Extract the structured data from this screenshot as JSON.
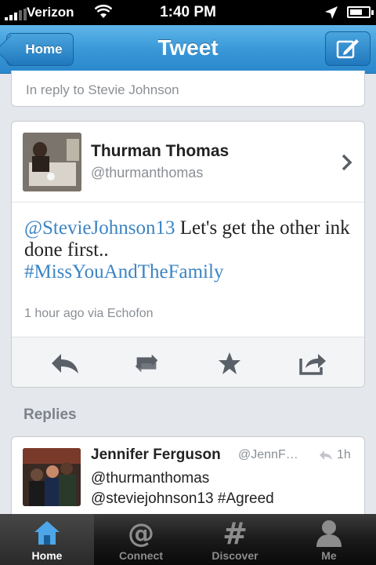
{
  "status_bar": {
    "carrier": "Verizon",
    "time": "1:40 PM",
    "battery_level": 0.7
  },
  "nav": {
    "back_label": "Home",
    "title": "Tweet"
  },
  "in_reply_to": "In reply to Stevie Johnson",
  "tweet": {
    "author_name": "Thurman Thomas",
    "author_handle": "@thurmanthomas",
    "mention": "@StevieJohnson13",
    "text_part1": " Let's get the other ink done first..",
    "hashtag": "#MissYouAndTheFamily",
    "meta": "1 hour ago via Echofon"
  },
  "replies_label": "Replies",
  "reply": {
    "author_name": "Jennifer Ferguson",
    "author_handle": "@JennF…",
    "time": "1h",
    "text_line1": "@thurmanthomas",
    "text_line2": "@steviejohnson13 #Agreed"
  },
  "tabs": [
    {
      "label": "Home",
      "icon": "home-icon",
      "active": true
    },
    {
      "label": "Connect",
      "icon": "at-icon",
      "active": false
    },
    {
      "label": "Discover",
      "icon": "hash-icon",
      "active": false
    },
    {
      "label": "Me",
      "icon": "person-icon",
      "active": false
    }
  ],
  "colors": {
    "accent": "#3b84c4",
    "nav_bar": "#3a98d8",
    "active_tab_icon": "#4da6e8"
  }
}
